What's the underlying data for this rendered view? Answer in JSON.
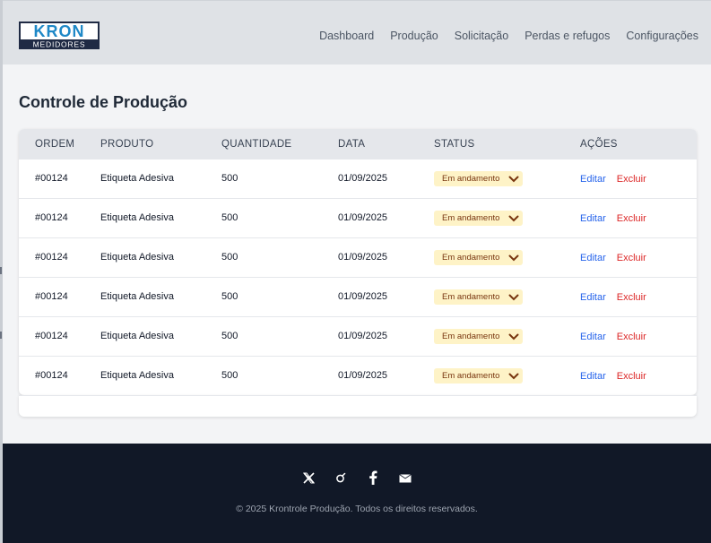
{
  "brand": {
    "logo_text_top": "KRON",
    "logo_text_bottom": "MEDIDORES",
    "colors": {
      "primary": "#1e88c7",
      "dark": "#1f2a44"
    }
  },
  "nav": {
    "items": [
      "Dashboard",
      "Produção",
      "Solicitação",
      "Perdas e refugos",
      "Configurações"
    ]
  },
  "page": {
    "title": "Controle de Produção"
  },
  "table": {
    "headers": [
      "ORDEM",
      "PRODUTO",
      "QUANTIDADE",
      "DATA",
      "STATUS",
      "AÇÕES"
    ],
    "rows": [
      {
        "ordem": "#00124",
        "produto": "Etiqueta Adesiva",
        "quantidade": "500",
        "data": "01/09/2025",
        "status": "Em andamento",
        "edit": "Editar",
        "delete": "Excluir"
      },
      {
        "ordem": "#00124",
        "produto": "Etiqueta Adesiva",
        "quantidade": "500",
        "data": "01/09/2025",
        "status": "Em andamento",
        "edit": "Editar",
        "delete": "Excluir"
      },
      {
        "ordem": "#00124",
        "produto": "Etiqueta Adesiva",
        "quantidade": "500",
        "data": "01/09/2025",
        "status": "Em andamento",
        "edit": "Editar",
        "delete": "Excluir"
      },
      {
        "ordem": "#00124",
        "produto": "Etiqueta Adesiva",
        "quantidade": "500",
        "data": "01/09/2025",
        "status": "Em andamento",
        "edit": "Editar",
        "delete": "Excluir"
      },
      {
        "ordem": "#00124",
        "produto": "Etiqueta Adesiva",
        "quantidade": "500",
        "data": "01/09/2025",
        "status": "Em andamento",
        "edit": "Editar",
        "delete": "Excluir"
      },
      {
        "ordem": "#00124",
        "produto": "Etiqueta Adesiva",
        "quantidade": "500",
        "data": "01/09/2025",
        "status": "Em andamento",
        "edit": "Editar",
        "delete": "Excluir"
      }
    ],
    "status_colors": {
      "background": "#fef3c7",
      "text": "#78350f"
    }
  },
  "footer": {
    "socials": [
      "x-icon",
      "threads-icon",
      "facebook-icon",
      "email-icon"
    ],
    "copyright": "© 2025 Krontrole Produção. Todos os direitos reservados."
  }
}
